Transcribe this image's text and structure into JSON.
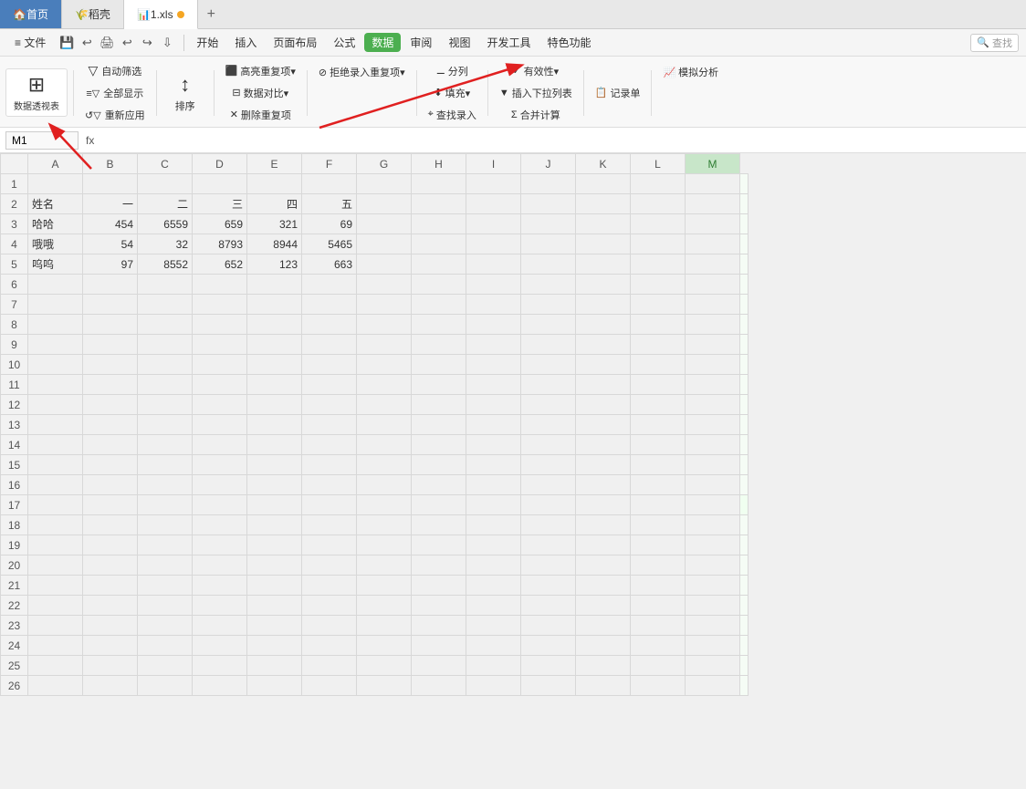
{
  "tabs": [
    {
      "id": "home",
      "label": "首页",
      "icon": "🏠",
      "active": false,
      "style": "home"
    },
    {
      "id": "chengke",
      "label": "稻壳",
      "icon": "🌾",
      "active": false,
      "style": "normal"
    },
    {
      "id": "excel",
      "label": "1.xls",
      "icon": "📊",
      "active": true,
      "style": "active",
      "dot": true
    }
  ],
  "menu": {
    "file_label": "≡ 文件",
    "items": [
      "开始",
      "插入",
      "页面布局",
      "公式",
      "数据",
      "审阅",
      "视图",
      "开发工具",
      "特色功能"
    ]
  },
  "search": {
    "placeholder": "查找",
    "icon": "🔍"
  },
  "toolbar": {
    "icons": [
      "💾",
      "↩",
      "🖨",
      "↩",
      "↪",
      "⇩"
    ]
  },
  "ribbon": {
    "active_tab": "数据",
    "buttons": [
      {
        "id": "pivot-table",
        "icon": "⊞",
        "label": "数据透视表",
        "large": true,
        "highlight": false
      },
      {
        "id": "auto-filter",
        "icon": "▽",
        "label": "自动筛选",
        "large": false
      },
      {
        "id": "full-show",
        "icon": "≡▽",
        "label": "全部显示",
        "large": false
      },
      {
        "id": "reapply",
        "icon": "↺▽",
        "label": "重新应用",
        "large": false
      },
      {
        "id": "sort",
        "icon": "↕",
        "label": "排序",
        "large": false
      },
      {
        "id": "highlight-dup",
        "icon": "⬛",
        "label": "高亮重复项▾",
        "large": false
      },
      {
        "id": "data-compare",
        "icon": "⊟",
        "label": "数据对比▾",
        "large": false
      },
      {
        "id": "remove-dup",
        "icon": "✕✕",
        "label": "删除重复项",
        "large": false
      },
      {
        "id": "reject-dup",
        "icon": "⊘",
        "label": "拒绝录入重复项▾",
        "large": false
      },
      {
        "id": "split-col",
        "icon": "|||",
        "label": "分列",
        "large": false
      },
      {
        "id": "fill",
        "icon": "⬇",
        "label": "填充▾",
        "large": false
      },
      {
        "id": "trace-input",
        "icon": "⌖",
        "label": "查找录入",
        "large": false
      },
      {
        "id": "valid",
        "icon": "✓⊟",
        "label": "有效性▾",
        "large": false
      },
      {
        "id": "insert-dropdown",
        "icon": "⊟▼",
        "label": "插入下拉列表",
        "large": false
      },
      {
        "id": "merge-calc",
        "icon": "Σ",
        "label": "合并计算",
        "large": false
      },
      {
        "id": "record",
        "icon": "📋",
        "label": "记录单",
        "large": false
      },
      {
        "id": "sim-analysis",
        "icon": "📈",
        "label": "模拟分析",
        "large": false
      }
    ]
  },
  "formula_bar": {
    "cell_ref": "M1",
    "formula_symbol": "fx"
  },
  "columns": [
    "",
    "A",
    "B",
    "C",
    "D",
    "E",
    "F",
    "G",
    "H",
    "I",
    "J",
    "K",
    "L",
    "M"
  ],
  "rows": [
    {
      "num": 1,
      "cells": [
        "",
        "",
        "",
        "",
        "",
        "",
        "",
        "",
        "",
        "",
        "",
        "",
        "",
        ""
      ]
    },
    {
      "num": 2,
      "cells": [
        "姓名",
        "一",
        "二",
        "三",
        "四",
        "五",
        "",
        "",
        "",
        "",
        "",
        "",
        "",
        ""
      ]
    },
    {
      "num": 3,
      "cells": [
        "哈哈",
        "454",
        "6559",
        "659",
        "321",
        "69",
        "",
        "",
        "",
        "",
        "",
        "",
        "",
        ""
      ]
    },
    {
      "num": 4,
      "cells": [
        "哦哦",
        "54",
        "32",
        "8793",
        "8944",
        "5465",
        "",
        "",
        "",
        "",
        "",
        "",
        "",
        ""
      ]
    },
    {
      "num": 5,
      "cells": [
        "呜呜",
        "97",
        "8552",
        "652",
        "123",
        "663",
        "",
        "",
        "",
        "",
        "",
        "",
        "",
        ""
      ]
    },
    {
      "num": 6,
      "cells": [
        "",
        "",
        "",
        "",
        "",
        "",
        "",
        "",
        "",
        "",
        "",
        "",
        "",
        ""
      ]
    },
    {
      "num": 7,
      "cells": [
        "",
        "",
        "",
        "",
        "",
        "",
        "",
        "",
        "",
        "",
        "",
        "",
        "",
        ""
      ]
    },
    {
      "num": 8,
      "cells": [
        "",
        "",
        "",
        "",
        "",
        "",
        "",
        "",
        "",
        "",
        "",
        "",
        "",
        ""
      ]
    },
    {
      "num": 9,
      "cells": [
        "",
        "",
        "",
        "",
        "",
        "",
        "",
        "",
        "",
        "",
        "",
        "",
        "",
        ""
      ]
    },
    {
      "num": 10,
      "cells": [
        "",
        "",
        "",
        "",
        "",
        "",
        "",
        "",
        "",
        "",
        "",
        "",
        "",
        ""
      ]
    },
    {
      "num": 11,
      "cells": [
        "",
        "",
        "",
        "",
        "",
        "",
        "",
        "",
        "",
        "",
        "",
        "",
        "",
        ""
      ]
    },
    {
      "num": 12,
      "cells": [
        "",
        "",
        "",
        "",
        "",
        "",
        "",
        "",
        "",
        "",
        "",
        "",
        "",
        ""
      ]
    },
    {
      "num": 13,
      "cells": [
        "",
        "",
        "",
        "",
        "",
        "",
        "",
        "",
        "",
        "",
        "",
        "",
        "",
        ""
      ]
    },
    {
      "num": 14,
      "cells": [
        "",
        "",
        "",
        "",
        "",
        "",
        "",
        "",
        "",
        "",
        "",
        "",
        "",
        ""
      ]
    },
    {
      "num": 15,
      "cells": [
        "",
        "",
        "",
        "",
        "",
        "",
        "",
        "",
        "",
        "",
        "",
        "",
        "",
        ""
      ]
    },
    {
      "num": 16,
      "cells": [
        "",
        "",
        "",
        "",
        "",
        "",
        "",
        "",
        "",
        "",
        "",
        "",
        "",
        ""
      ]
    },
    {
      "num": 17,
      "cells": [
        "",
        "",
        "",
        "",
        "",
        "",
        "",
        "",
        "",
        "",
        "",
        "",
        "",
        ""
      ]
    },
    {
      "num": 18,
      "cells": [
        "",
        "",
        "",
        "",
        "",
        "",
        "",
        "",
        "",
        "",
        "",
        "",
        "",
        ""
      ]
    },
    {
      "num": 19,
      "cells": [
        "",
        "",
        "",
        "",
        "",
        "",
        "",
        "",
        "",
        "",
        "",
        "",
        "",
        ""
      ]
    },
    {
      "num": 20,
      "cells": [
        "",
        "",
        "",
        "",
        "",
        "",
        "",
        "",
        "",
        "",
        "",
        "",
        "",
        ""
      ]
    },
    {
      "num": 21,
      "cells": [
        "",
        "",
        "",
        "",
        "",
        "",
        "",
        "",
        "",
        "",
        "",
        "",
        "",
        ""
      ]
    },
    {
      "num": 22,
      "cells": [
        "",
        "",
        "",
        "",
        "",
        "",
        "",
        "",
        "",
        "",
        "",
        "",
        "",
        ""
      ]
    },
    {
      "num": 23,
      "cells": [
        "",
        "",
        "",
        "",
        "",
        "",
        "",
        "",
        "",
        "",
        "",
        "",
        "",
        ""
      ]
    },
    {
      "num": 24,
      "cells": [
        "",
        "",
        "",
        "",
        "",
        "",
        "",
        "",
        "",
        "",
        "",
        "",
        "",
        ""
      ]
    },
    {
      "num": 25,
      "cells": [
        "",
        "",
        "",
        "",
        "",
        "",
        "",
        "",
        "",
        "",
        "",
        "",
        "",
        ""
      ]
    },
    {
      "num": 26,
      "cells": [
        "",
        "",
        "",
        "",
        "",
        "",
        "",
        "",
        "",
        "",
        "",
        "",
        "",
        ""
      ]
    }
  ],
  "selected_cell": {
    "row": 17,
    "col": 13
  },
  "annotations": {
    "arrow1_label": "数据透视表 arrow",
    "arrow2_label": "数据 tab arrow"
  }
}
